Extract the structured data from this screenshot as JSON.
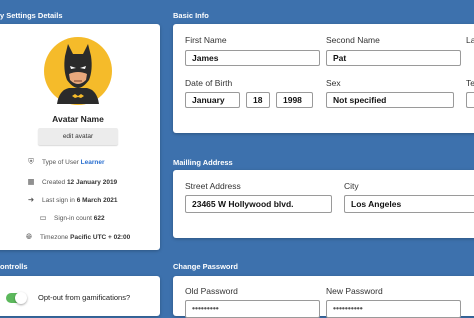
{
  "sections": {
    "settings_title": "y Settings Details",
    "basic_info_title": "Basic Info",
    "mailing_title": "Mailling Address",
    "controls_title": "ontrolls",
    "password_title": "Change Password"
  },
  "profile": {
    "name": "Avatar Name",
    "edit_avatar_label": "edit avatar",
    "user_type_label": "Type of User",
    "user_type_value": "Learner",
    "created_label": "Created",
    "created_value": "12 January 2019",
    "last_sign_label": "Last sign in",
    "last_sign_value": "6 March 2021",
    "sign_count_label": "Sign-in count",
    "sign_count_value": "622",
    "timezone_label": "Timezone",
    "timezone_value": "Pacific UTC + 02:00"
  },
  "basic_info": {
    "first_name_label": "First Name",
    "first_name_value": "James",
    "second_name_label": "Second Name",
    "second_name_value": "Pat",
    "third_label_partial": "La",
    "dob_label": "Date of Birth",
    "dob_month": "January",
    "dob_day": "18",
    "dob_year": "1998",
    "sex_label": "Sex",
    "sex_value": "Not specified",
    "extra_label_partial": "Te"
  },
  "mailing": {
    "street_label": "Street Address",
    "street_value": "23465 W Hollywood blvd.",
    "city_label": "City",
    "city_value": "Los Angeles"
  },
  "controls": {
    "gamification_label": "Opt-out from gamifications?"
  },
  "password": {
    "old_label": "Old Password",
    "new_label": "New Password"
  },
  "icons": {
    "user_type": "shield-user-icon",
    "created": "calendar-icon",
    "last_sign": "sign-in-icon",
    "sign_count": "monitor-icon",
    "timezone": "globe-icon"
  },
  "colors": {
    "background": "#3d71ad",
    "avatar_circle": "#f5bb2a",
    "link": "#2a6fd0",
    "toggle_on": "#5cb85c"
  }
}
